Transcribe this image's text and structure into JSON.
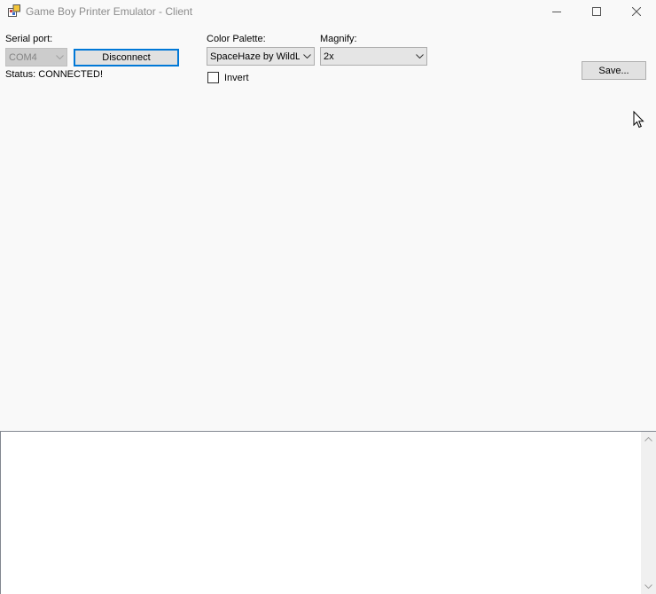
{
  "window": {
    "title": "Game Boy Printer Emulator - Client"
  },
  "serial": {
    "label": "Serial port:",
    "port_value": "COM4",
    "connect_button": "Disconnect",
    "status": "Status: CONNECTED!"
  },
  "palette": {
    "label": "Color Palette:",
    "value": "SpaceHaze by WildL",
    "invert_label": "Invert",
    "invert_checked": false
  },
  "magnify": {
    "label": "Magnify:",
    "value": "2x"
  },
  "save_button": "Save...",
  "log": {
    "text": ""
  },
  "icons": [
    "app-icon",
    "minimize-icon",
    "maximize-icon",
    "close-icon",
    "chevron-down-icon",
    "mouse-cursor-icon",
    "scroll-up-arrow-icon",
    "scroll-down-arrow-icon"
  ]
}
